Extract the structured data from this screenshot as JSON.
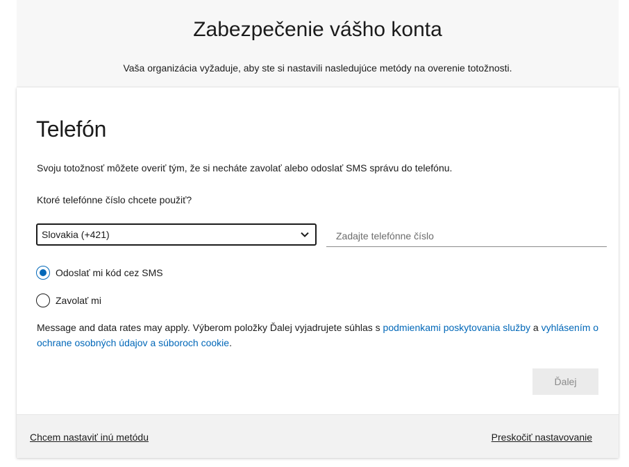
{
  "header": {
    "title": "Zabezpečenie vášho konta",
    "subtitle": "Vaša organizácia vyžaduje, aby ste si nastavili nasledujúce metódy na overenie totožnosti."
  },
  "card": {
    "title": "Telefón",
    "description": "Svoju totožnosť môžete overiť tým, že si necháte zavolať alebo odoslať SMS správu do telefónu.",
    "question": "Ktoré telefónne číslo chcete použiť?",
    "country_select": {
      "value": "Slovakia (+421)",
      "icon": "chevron-down-icon"
    },
    "phone_input": {
      "value": "",
      "placeholder": "Zadajte telefónne číslo"
    },
    "options": [
      {
        "label": "Odoslať mi kód cez SMS",
        "checked": true
      },
      {
        "label": "Zavolať mi",
        "checked": false
      }
    ],
    "legal": {
      "text_before": "Message and data rates may apply. Výberom položky Ďalej vyjadrujete súhlas s ",
      "terms_link": "podmienkami poskytovania služby",
      "text_middle": " a ",
      "privacy_link": "vyhlásením o ochrane osobných údajov a súboroch cookie",
      "text_after": "."
    },
    "next_label": "Ďalej"
  },
  "footer": {
    "alt_method": "Chcem nastaviť inú metódu",
    "skip": "Preskočiť nastavovanie"
  },
  "colors": {
    "accent": "#0067b8",
    "text": "#1b1b1b",
    "top_bg": "#f7f7f7",
    "footer_bg": "#f2f2f2"
  }
}
